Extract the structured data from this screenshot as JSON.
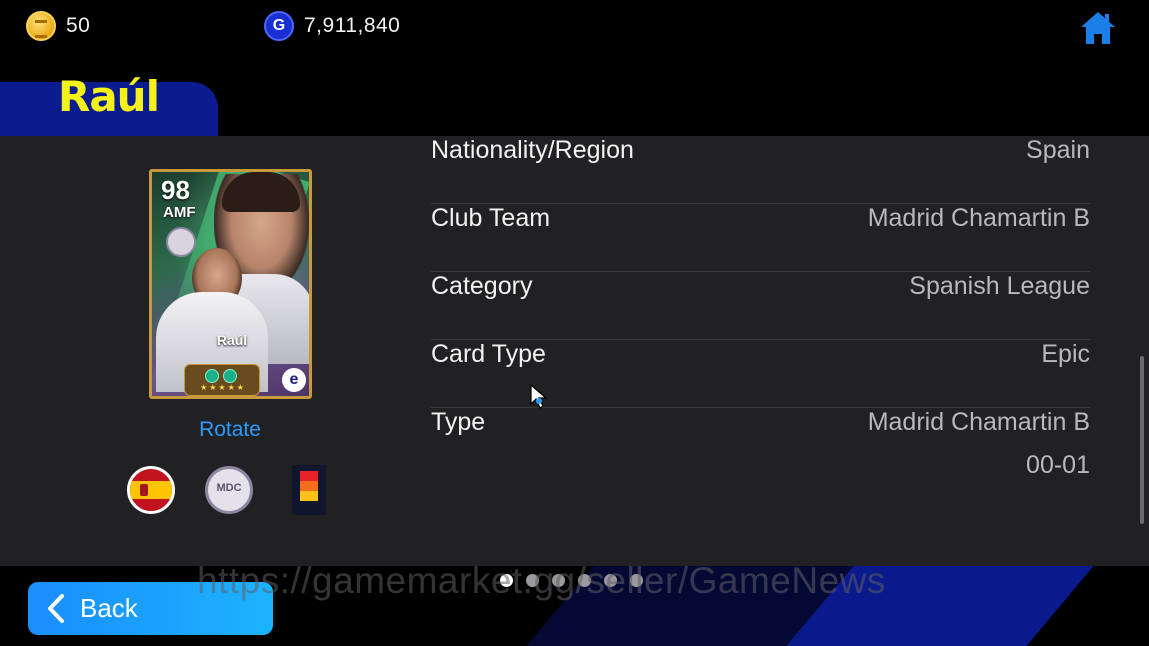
{
  "currency": {
    "coins_value": "50",
    "gp_icon_letter": "G",
    "gp_value": "7,911,840"
  },
  "player": {
    "name": "Raúl"
  },
  "card": {
    "rating": "98",
    "position": "AMF",
    "name": "Raúl",
    "club_badge_text": "MDC",
    "stars": "★★★★★",
    "brand_letter": "e"
  },
  "rotate_label": "Rotate",
  "badges": {
    "club_text": "MDC"
  },
  "info": [
    {
      "label": "Nationality/Region",
      "value": "Spain"
    },
    {
      "label": "Club Team",
      "value": "Madrid Chamartin B"
    },
    {
      "label": "Category",
      "value": "Spanish League"
    },
    {
      "label": "Card Type",
      "value": "Epic"
    },
    {
      "label": "Type",
      "value": "Madrid Chamartin B",
      "value_line2": "00-01"
    }
  ],
  "pagination": {
    "total": 6,
    "active": 1
  },
  "back_label": "Back",
  "watermark": "https://gamemarket.gg/seller/GameNews",
  "colors": {
    "title_yellow": "#f5f219",
    "accent_blue": "#2b9cff",
    "panel": "#212124",
    "home_icon_blue": "#1a7fe8"
  },
  "icons": [
    "coin-icon",
    "gp-icon",
    "home-icon",
    "back-chevron-icon",
    "cursor-icon"
  ]
}
